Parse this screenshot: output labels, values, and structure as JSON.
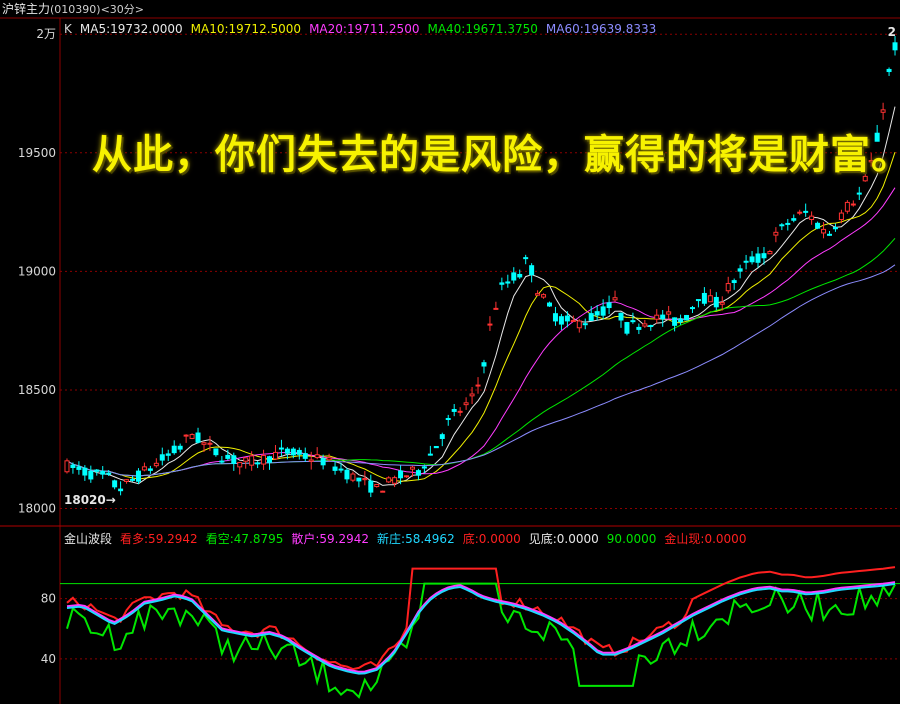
{
  "window": {
    "title": "沪锌主力",
    "code": "(010390)",
    "period": "<30分>"
  },
  "main_legend": [
    {
      "label": "K",
      "color": "#d8d8d8"
    },
    {
      "label": "MA5:19732.0000",
      "color": "#e8e8e8"
    },
    {
      "label": "MA10:19712.5000",
      "color": "#f0f000"
    },
    {
      "label": "MA20:19711.2500",
      "color": "#ff3cff"
    },
    {
      "label": "MA40:19671.3750",
      "color": "#00e600"
    },
    {
      "label": "MA60:19639.8333",
      "color": "#8c8cff"
    }
  ],
  "osc_legend": [
    {
      "label": "金山波段",
      "color": "#e8e8e8"
    },
    {
      "label": "看多:59.2942",
      "color": "#ff2020"
    },
    {
      "label": "看空:47.8795",
      "color": "#00e600"
    },
    {
      "label": "散户:59.2942",
      "color": "#ff3cff"
    },
    {
      "label": "新庄:58.4962",
      "color": "#20d8ff"
    },
    {
      "label": "底:0.0000",
      "color": "#ff2020"
    },
    {
      "label": "见底:0.0000",
      "color": "#e8e8e8"
    },
    {
      "label": "90.0000",
      "color": "#00e600"
    },
    {
      "label": "金山现:0.0000",
      "color": "#ff2020"
    }
  ],
  "headline": "从此，你们失去的是风险，赢得的将是财富。",
  "colors": {
    "up": "#ff3232",
    "down": "#00ffff",
    "grid": "#8b0000",
    "axis_text": "#d8d8d8"
  },
  "chart_data": [
    {
      "type": "candlestick",
      "ylim": [
        17960,
        20060
      ],
      "yticks": [
        {
          "value": 18000,
          "label": "18000"
        },
        {
          "value": 18500,
          "label": "18500"
        },
        {
          "value": 19000,
          "label": "19000"
        },
        {
          "value": 19500,
          "label": "19500"
        },
        {
          "value": 20000,
          "label": "2万"
        }
      ],
      "annotations": [
        {
          "text": "18020→",
          "value": 18020
        },
        {
          "text": "2",
          "value": 20010
        }
      ],
      "series": [
        {
          "name": "MA5",
          "color": "#e8e8e8"
        },
        {
          "name": "MA10",
          "color": "#f0f000"
        },
        {
          "name": "MA20",
          "color": "#ff3cff"
        },
        {
          "name": "MA40",
          "color": "#00e600"
        },
        {
          "name": "MA60",
          "color": "#8c8cff"
        }
      ]
    },
    {
      "type": "line",
      "ylim": [
        10,
        115
      ],
      "yticks": [
        {
          "value": 40,
          "label": "40"
        },
        {
          "value": 80,
          "label": "80"
        }
      ],
      "reference_line": 90,
      "series": [
        {
          "name": "看多",
          "color": "#ff2020"
        },
        {
          "name": "看空",
          "color": "#00e600"
        },
        {
          "name": "散户",
          "color": "#ff3cff"
        },
        {
          "name": "新庄",
          "color": "#20d8ff"
        }
      ]
    }
  ]
}
